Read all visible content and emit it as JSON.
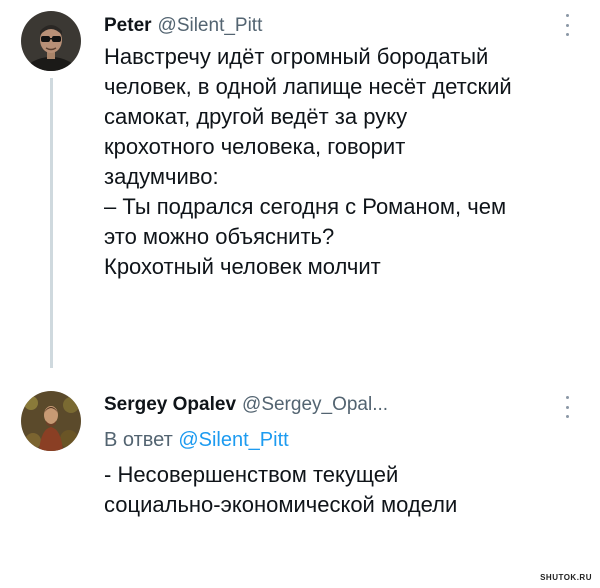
{
  "tweets": [
    {
      "author_name": "Peter",
      "author_handle": "@Silent_Pitt",
      "text_lines": [
        "Навстречу идёт огромный бородатый",
        "человек, в одной лапище несёт детский",
        "самокат, другой ведёт за руку",
        "крохотного человека, говорит",
        "задумчиво:",
        "– Ты подрался сегодня с Романом, чем",
        "это можно объяснить?",
        "Крохотный человек молчит"
      ]
    },
    {
      "author_name": "Sergey Opalev",
      "author_handle": "@Sergey_Opal...",
      "reply_prefix": "В ответ",
      "reply_mention": "@Silent_Pitt",
      "text_lines": [
        "- Несовершенством текущей",
        "социально-экономической модели"
      ]
    }
  ],
  "watermark": "SHUTOK.RU",
  "colors": {
    "text": "#0f1419",
    "secondary": "#536471",
    "mention": "#1d9bf0",
    "thread_line": "#cfd9de"
  }
}
